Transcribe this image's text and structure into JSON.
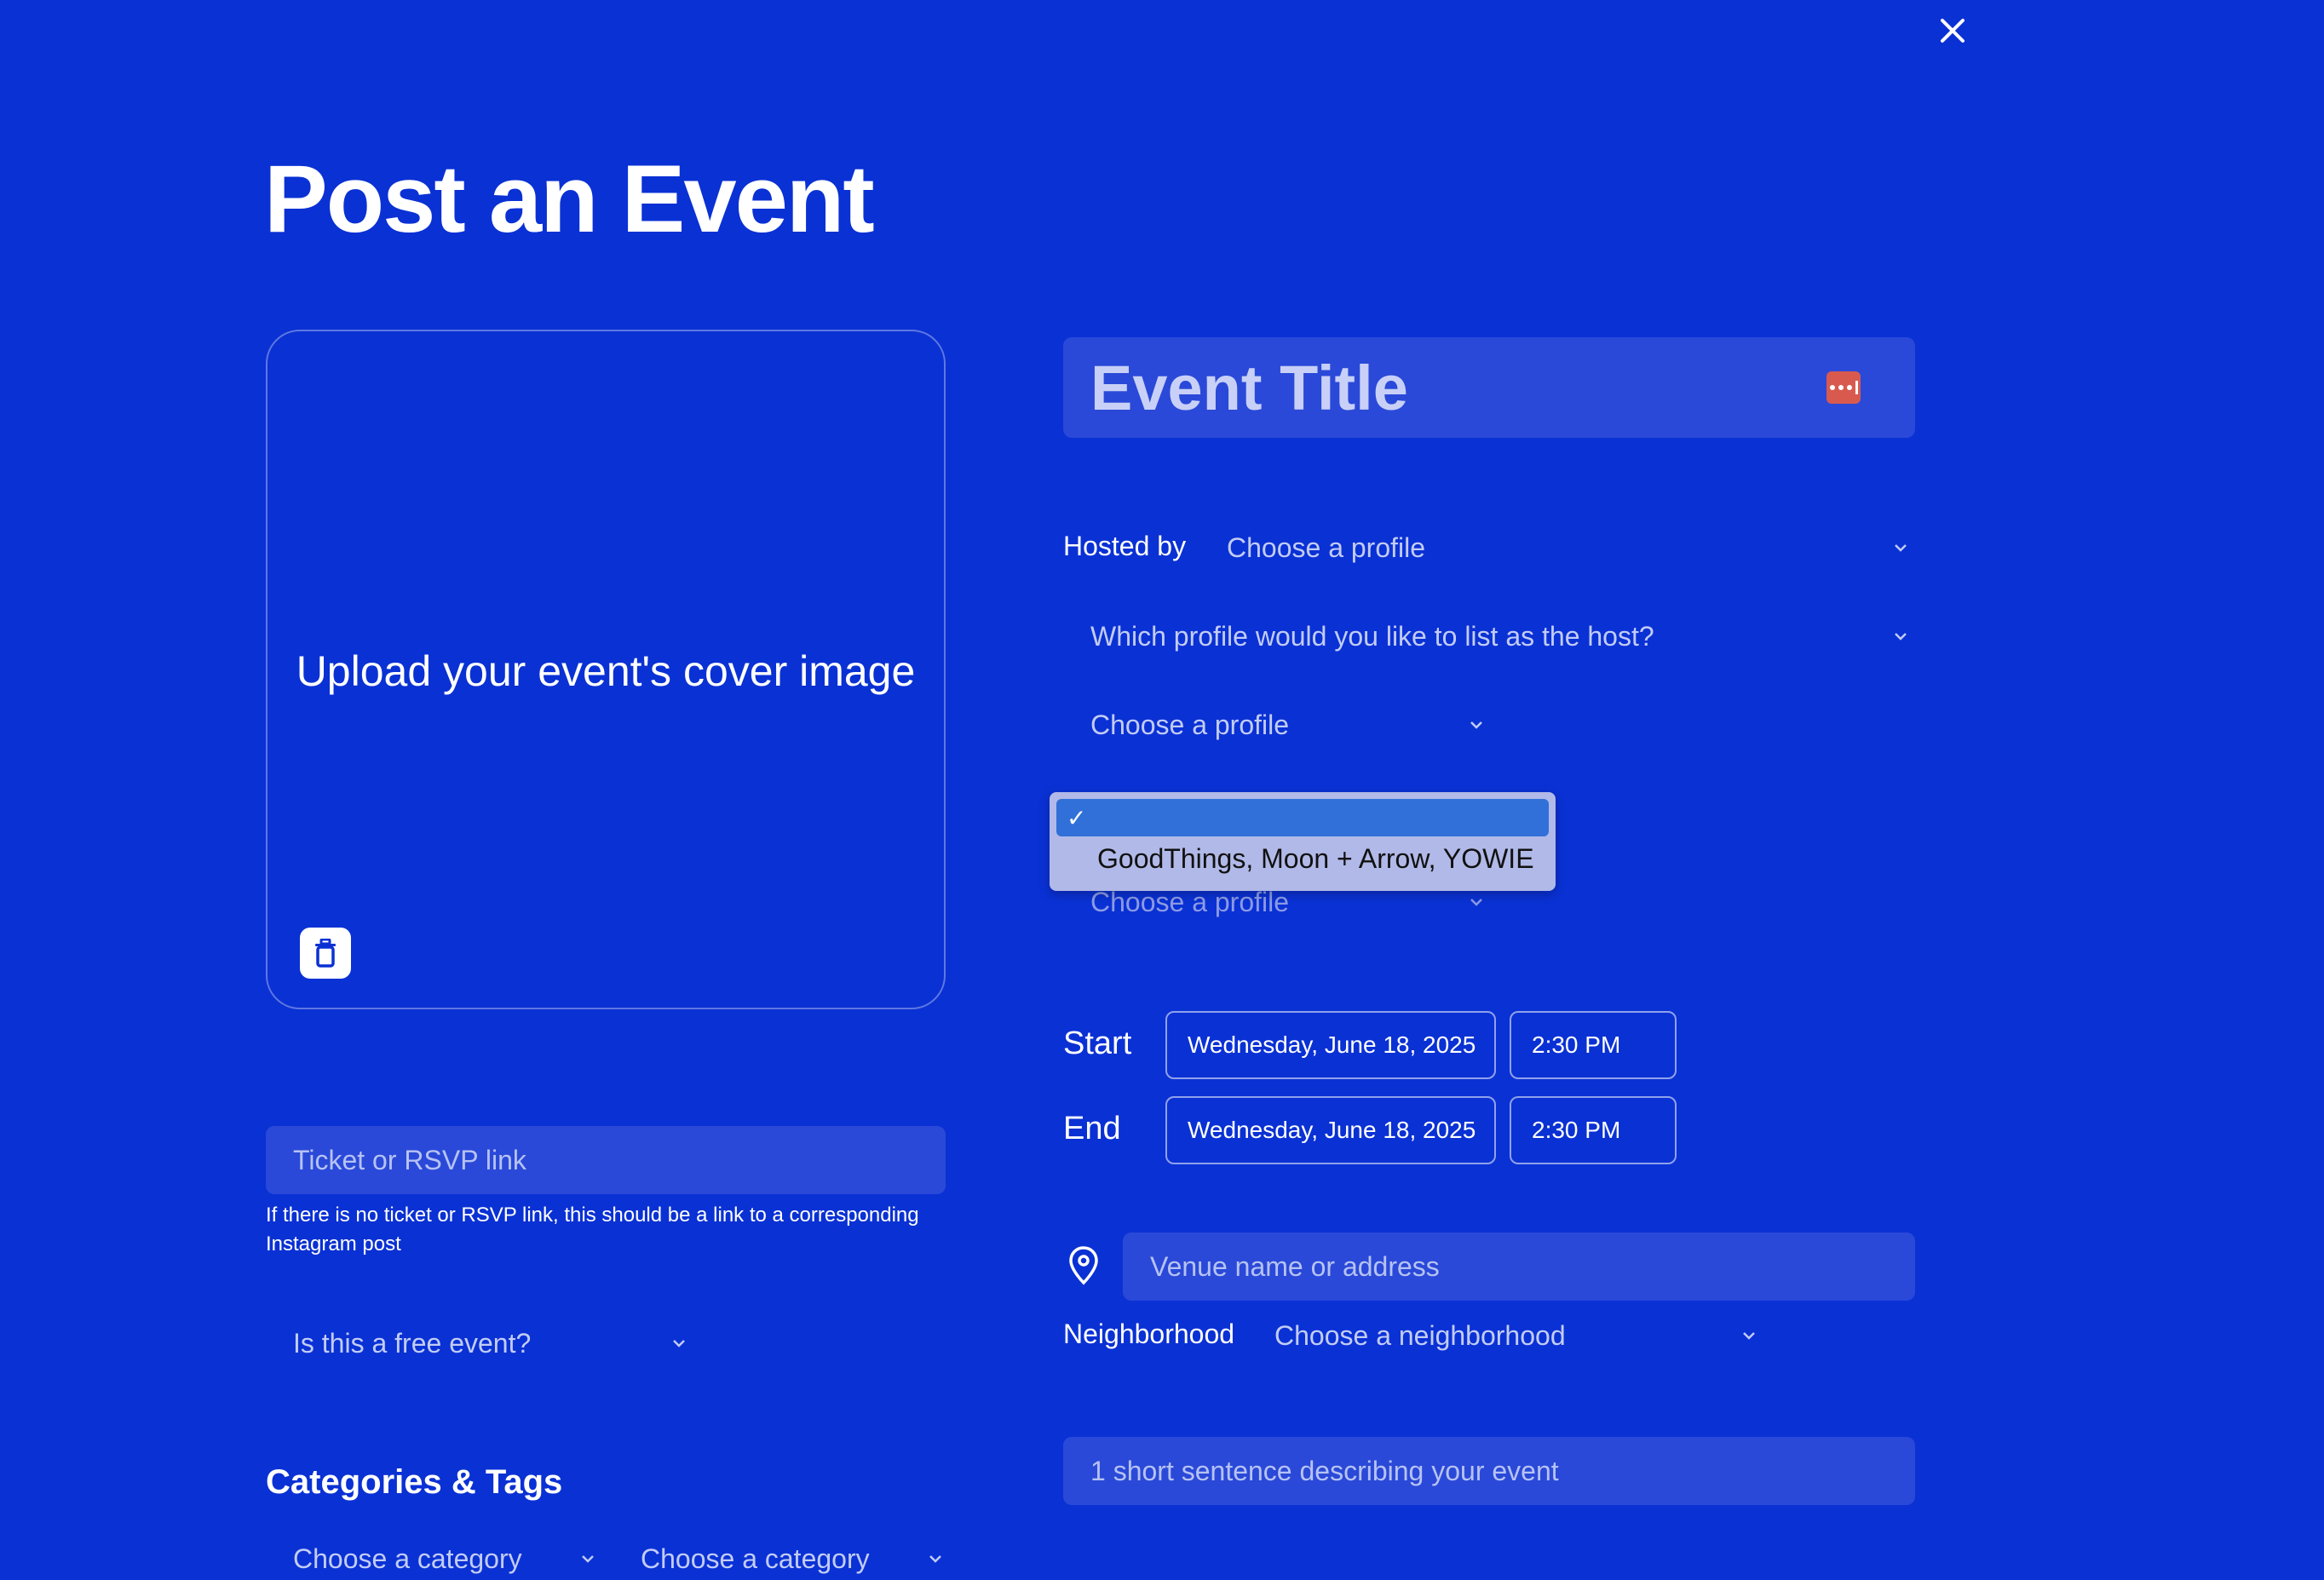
{
  "page": {
    "title": "Post an Event"
  },
  "upload": {
    "label": "Upload your event's cover image"
  },
  "event_title": {
    "placeholder": "Event Title"
  },
  "host": {
    "label": "Hosted by",
    "select_value": "Choose a profile",
    "which_profile": "Which profile would you like to list as the host?",
    "profile_1": "Choose a profile",
    "profile_3": "Choose a profile"
  },
  "dropdown": {
    "selected_mark": "✓",
    "option": "GoodThings, Moon + Arrow, YOWIE"
  },
  "schedule": {
    "start_label": "Start",
    "end_label": "End",
    "start_date": "Wednesday, June 18, 2025",
    "start_time": "2:30 PM",
    "end_date": "Wednesday, June 18, 2025",
    "end_time": "2:30 PM"
  },
  "ticket": {
    "placeholder": "Ticket or RSVP link",
    "help": "If there is no ticket or RSVP link, this should be a link to a corresponding Instagram post"
  },
  "free_event": {
    "select_value": "Is this a free event?"
  },
  "categories": {
    "heading": "Categories & Tags",
    "select_1": "Choose a category",
    "select_2": "Choose a category"
  },
  "location": {
    "venue_placeholder": "Venue name or address",
    "neighborhood_label": "Neighborhood",
    "neighborhood_value": "Choose a neighborhood"
  },
  "description": {
    "placeholder": "1 short sentence describing your event"
  },
  "colors": {
    "background": "#0a31d4",
    "field": "#2a49d8",
    "dropdown": "#b1b9e8",
    "accent": "#3070d8"
  },
  "icons": [
    "close-icon",
    "trash-icon",
    "password-manager-icon",
    "chevron-down-icon",
    "map-pin-icon"
  ]
}
